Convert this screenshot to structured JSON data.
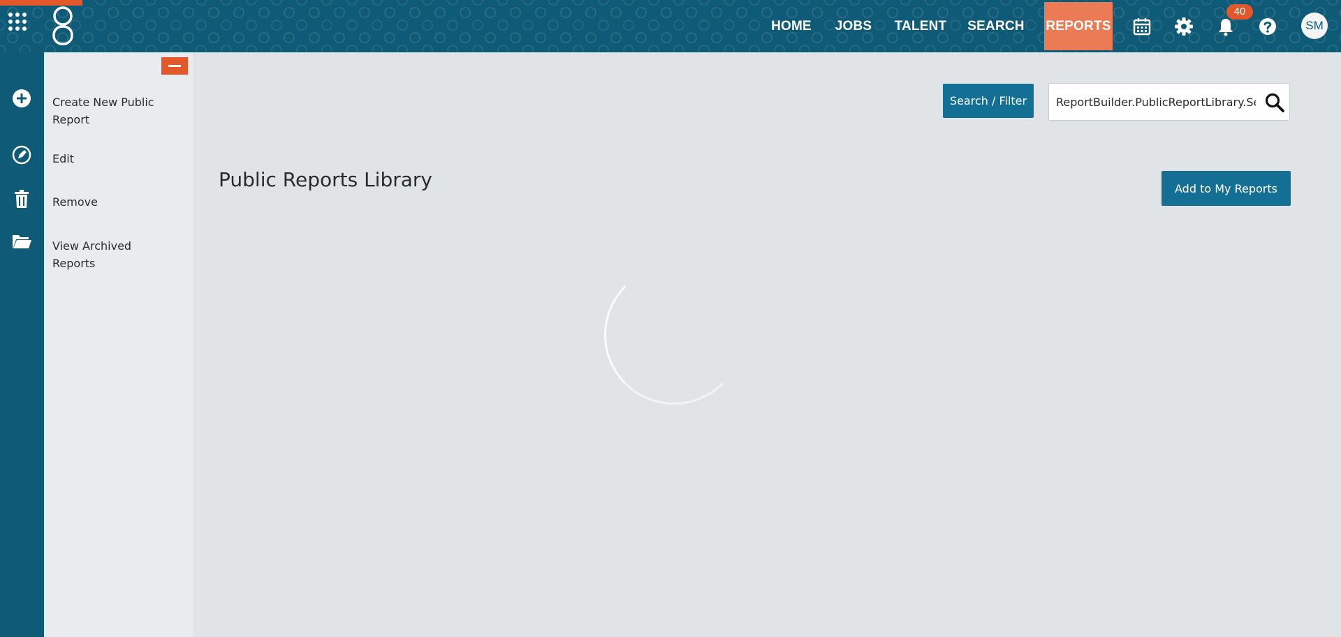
{
  "topbar": {
    "nav": [
      {
        "label": "HOME",
        "active": false
      },
      {
        "label": "JOBS",
        "active": false
      },
      {
        "label": "TALENT",
        "active": false
      },
      {
        "label": "SEARCH",
        "active": false
      },
      {
        "label": "REPORTS",
        "active": true
      }
    ],
    "notification_count": "40",
    "avatar_initials": "SM",
    "icons": [
      "apps-grid-icon",
      "logo-icon",
      "calendar-icon",
      "gear-icon",
      "bell-icon",
      "help-icon"
    ]
  },
  "rail": {
    "icons": [
      "plus-circle-icon",
      "edit-compass-icon",
      "trash-icon",
      "open-folder-icon"
    ]
  },
  "sidebar": {
    "items": [
      {
        "label": "Create New Public Report"
      },
      {
        "label": "Edit"
      },
      {
        "label": "Remove"
      },
      {
        "label": "View Archived Reports"
      }
    ]
  },
  "main": {
    "search_filter_label": "Search / Filter",
    "search_value": "ReportBuilder.PublicReportLibrary.Se",
    "title": "Public Reports Library",
    "add_button_label": "Add to My Reports"
  },
  "colors": {
    "primary": "#0e5a77",
    "button": "#136f93",
    "accent": "#e2582b",
    "active_tab": "#ea7b55",
    "main_bg": "#e0e4e6",
    "sidebar_bg": "#e8ecee"
  }
}
